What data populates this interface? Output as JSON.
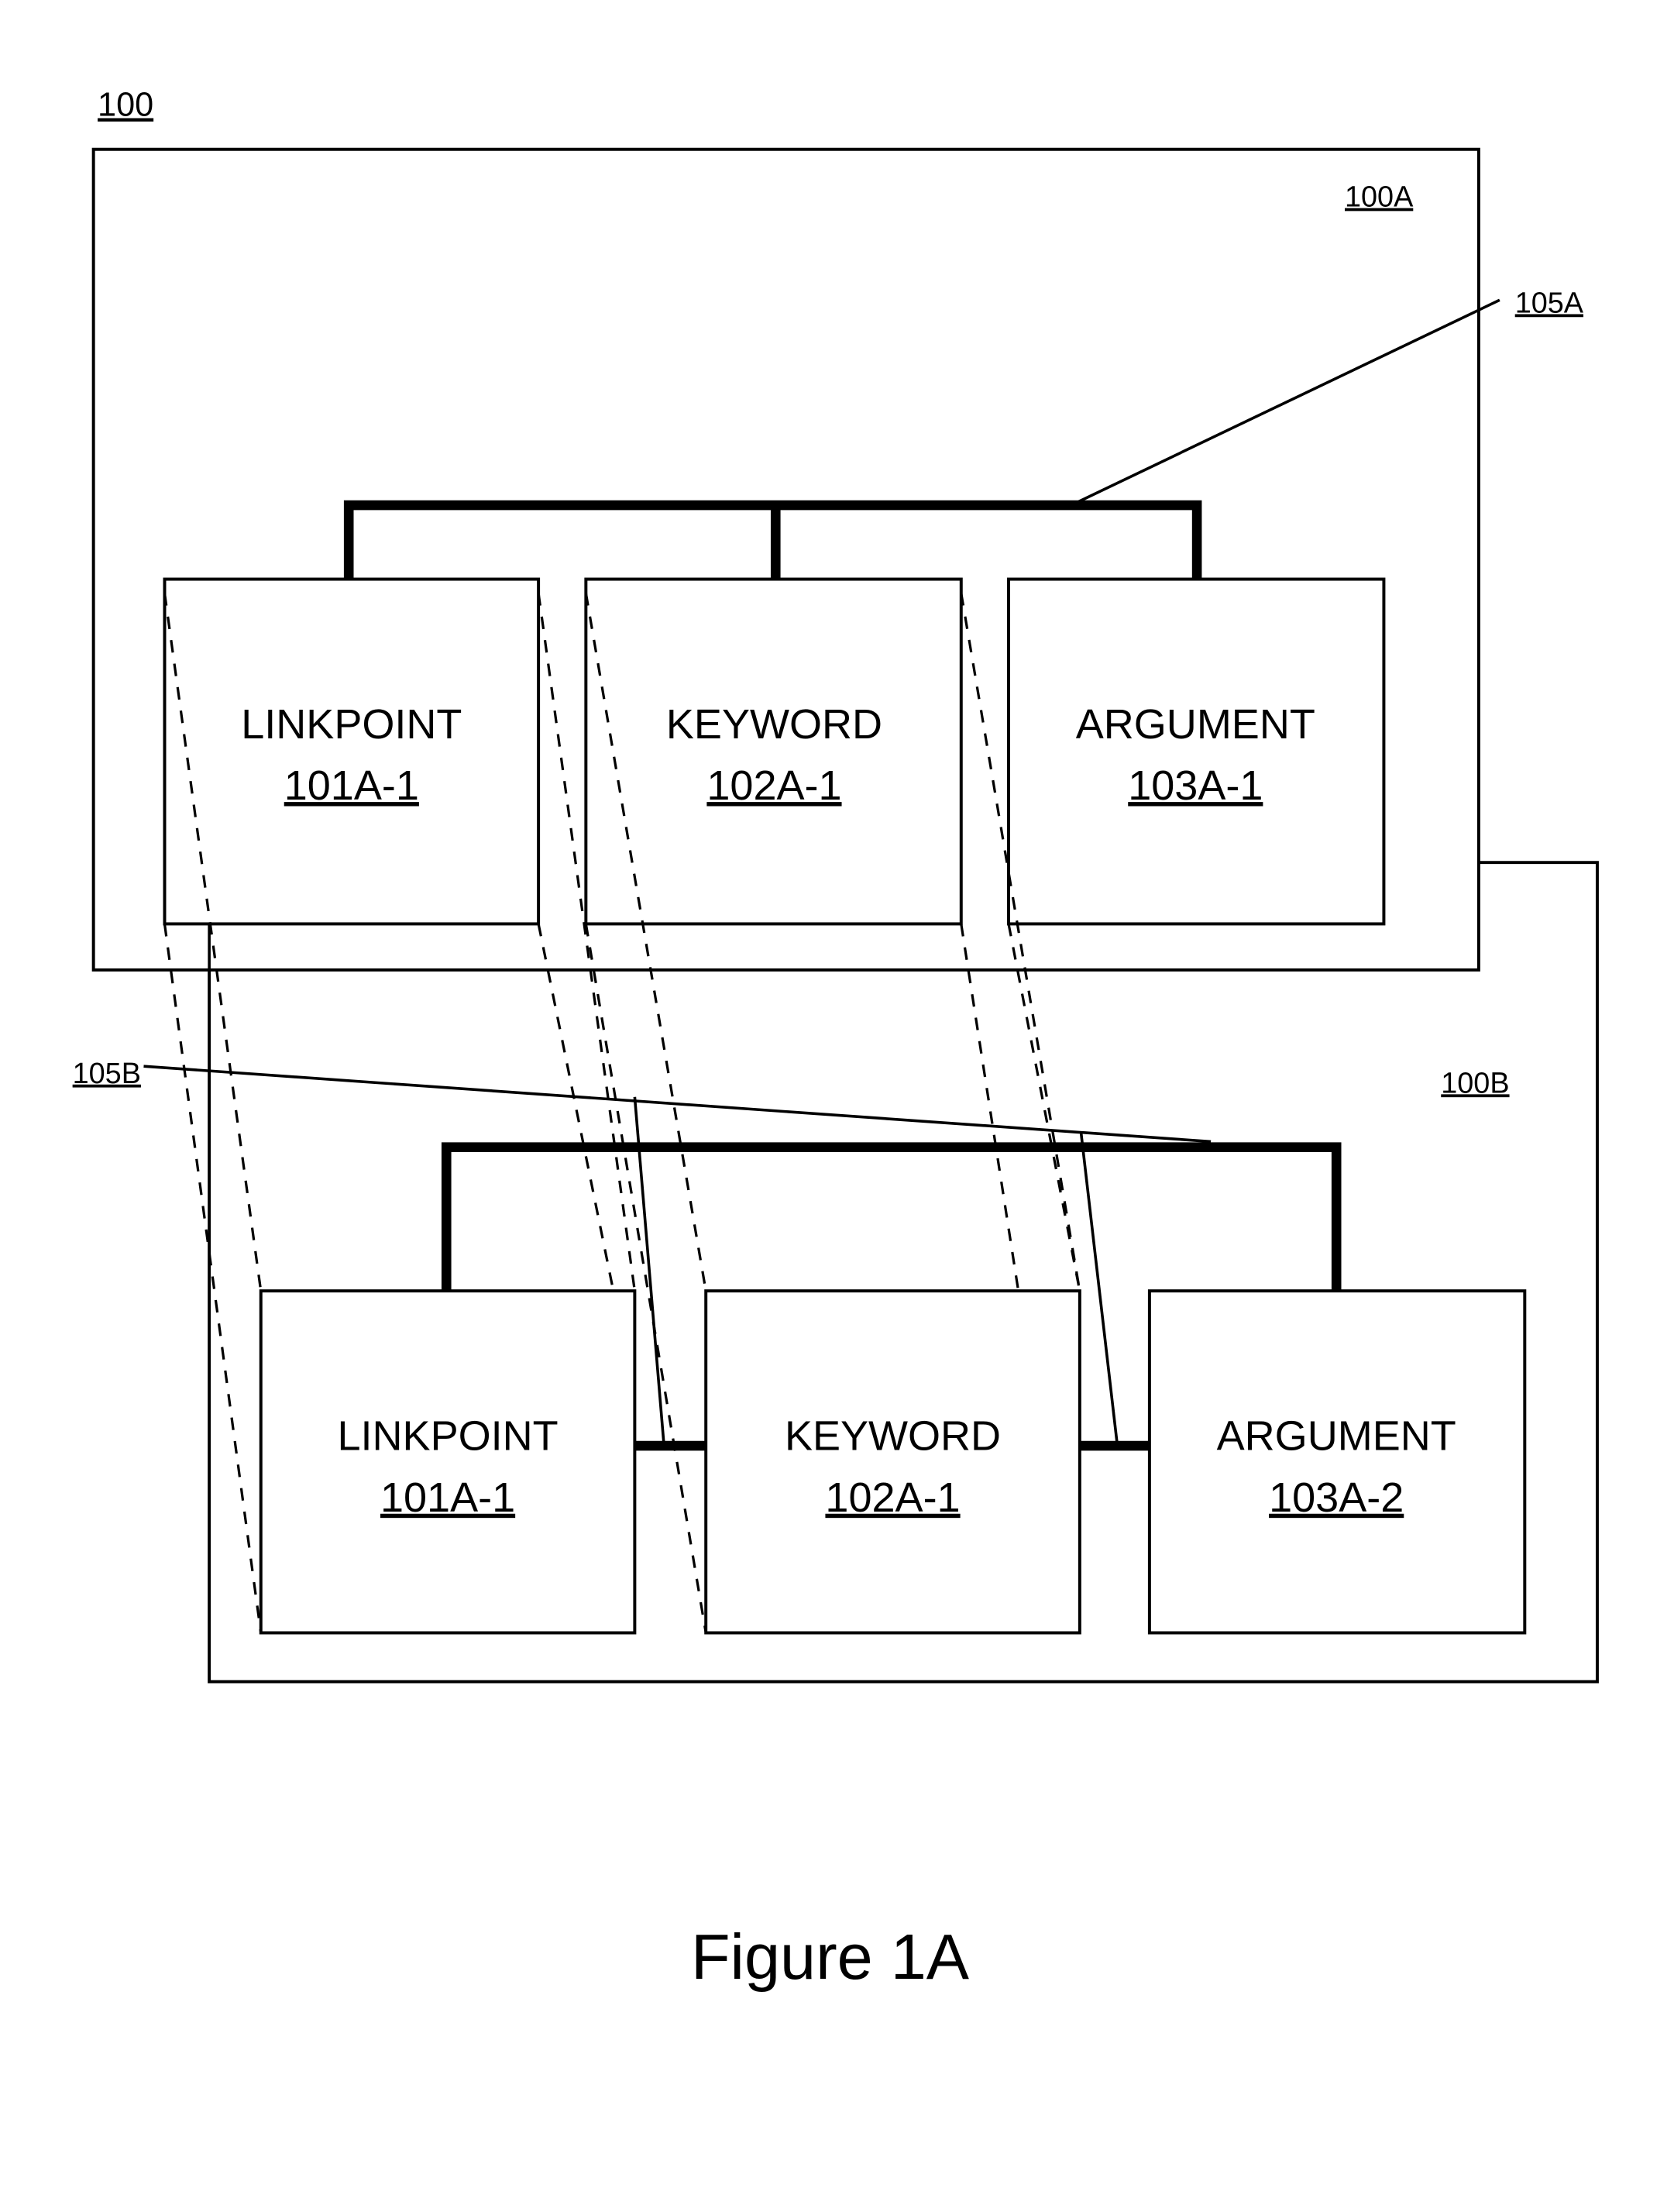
{
  "figure": {
    "reference_label": "100",
    "caption": "Figure 1A"
  },
  "containers": {
    "top": {
      "label": "100A"
    },
    "bottom": {
      "label": "100B"
    }
  },
  "buses": {
    "top": {
      "label": "105A"
    },
    "bottom": {
      "label": "105B"
    }
  },
  "top_nodes": [
    {
      "title": "LINKPOINT",
      "ref": "101A-1"
    },
    {
      "title": "KEYWORD",
      "ref": "102A-1"
    },
    {
      "title": "ARGUMENT",
      "ref": "103A-1"
    }
  ],
  "bottom_nodes": [
    {
      "title": "LINKPOINT",
      "ref": "101A-1"
    },
    {
      "title": "KEYWORD",
      "ref": "102A-1"
    },
    {
      "title": "ARGUMENT",
      "ref": "103A-2"
    }
  ],
  "colors": {
    "ink": "#000000",
    "paper": "#ffffff"
  }
}
